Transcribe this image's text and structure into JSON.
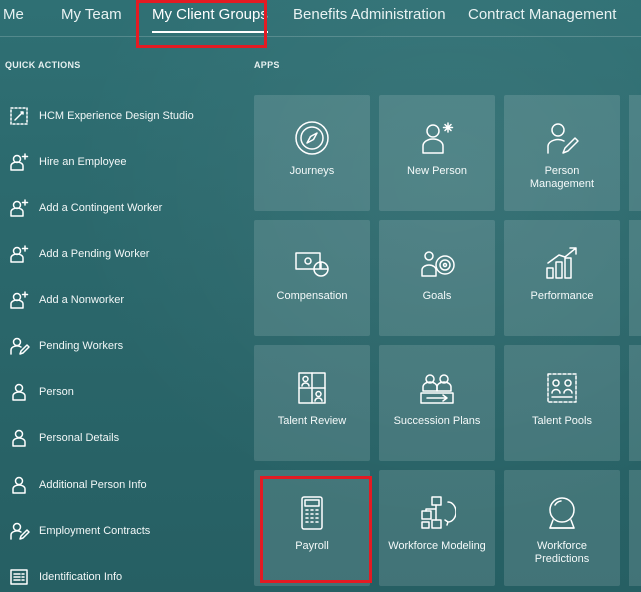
{
  "tabs": [
    {
      "label": "Me"
    },
    {
      "label": "My Team"
    },
    {
      "label": "My Client Groups",
      "active": true
    },
    {
      "label": "Benefits Administration"
    },
    {
      "label": "Contract Management"
    }
  ],
  "quick_actions": {
    "title": "QUICK ACTIONS",
    "items": [
      {
        "label": "HCM Experience Design Studio",
        "icon": "design-studio-icon"
      },
      {
        "label": "Hire an Employee",
        "icon": "add-person-icon"
      },
      {
        "label": "Add a Contingent Worker",
        "icon": "add-person-icon"
      },
      {
        "label": "Add a Pending Worker",
        "icon": "add-person-icon"
      },
      {
        "label": "Add a Nonworker",
        "icon": "add-person-icon"
      },
      {
        "label": "Pending Workers",
        "icon": "edit-person-icon"
      },
      {
        "label": "Person",
        "icon": "person-icon"
      },
      {
        "label": "Personal Details",
        "icon": "person-icon"
      },
      {
        "label": "Additional Person Info",
        "icon": "person-icon"
      },
      {
        "label": "Employment Contracts",
        "icon": "edit-person-icon"
      },
      {
        "label": "Identification Info",
        "icon": "id-card-icon"
      }
    ]
  },
  "apps": {
    "title": "APPS",
    "tiles": [
      {
        "label": "Journeys",
        "icon": "compass-icon"
      },
      {
        "label": "New Person",
        "icon": "new-person-icon"
      },
      {
        "label": "Person Management",
        "icon": "person-edit-icon"
      },
      {
        "label": "Compensation",
        "icon": "compensation-icon"
      },
      {
        "label": "Goals",
        "icon": "goals-icon"
      },
      {
        "label": "Performance",
        "icon": "performance-chart-icon"
      },
      {
        "label": "Talent Review",
        "icon": "talent-review-icon"
      },
      {
        "label": "Succession Plans",
        "icon": "succession-icon"
      },
      {
        "label": "Talent Pools",
        "icon": "talent-pool-icon"
      },
      {
        "label": "Payroll",
        "icon": "calculator-icon"
      },
      {
        "label": "Workforce Modeling",
        "icon": "workforce-modeling-icon"
      },
      {
        "label": "Workforce Predictions",
        "icon": "crystal-ball-icon"
      }
    ]
  },
  "colors": {
    "highlight": "#e31b23",
    "background": "#2a6a6e"
  }
}
